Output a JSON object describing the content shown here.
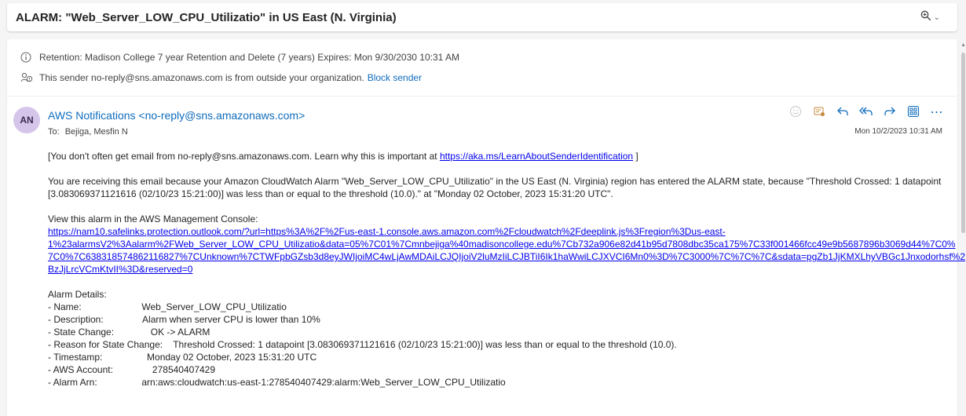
{
  "subject": "ALARM: \"Web_Server_LOW_CPU_Utilizatio\" in US East (N. Virginia)",
  "header": {
    "retention": "Retention: Madison College 7 year Retention and Delete (7 years) Expires: Mon 9/30/2030 10:31 AM",
    "outside_sender": "This sender no-reply@sns.amazonaws.com is from outside your organization.",
    "block_sender": "Block sender"
  },
  "message": {
    "avatar_initials": "AN",
    "sender": "AWS Notifications <no-reply@sns.amazonaws.com>",
    "to_label": "To:",
    "to_value": "Bejiga, Mesfin N",
    "date": "Mon 10/2/2023 10:31 AM"
  },
  "body": {
    "p1_text": "[You don't often get email from no-reply@sns.amazonaws.com. Learn why this is important at ",
    "p1_link": "https://aka.ms/LearnAboutSenderIdentification",
    "p1_end": " ]",
    "p2_line1": "You are receiving this email because your Amazon CloudWatch Alarm \"Web_Server_LOW_CPU_Utilizatio\" in the US East (N. Virginia) region has entered the ALARM state, because \"Threshold Crossed: 1 datapoint",
    "p2_line2": "[3.083069371121616 (02/10/23 15:21:00)] was less than or equal to the threshold (10.0).\" at \"Monday 02 October, 2023 15:31:20 UTC\".",
    "view_label": "View this alarm in the AWS Management Console:",
    "url_lines": [
      "https://nam10.safelinks.protection.outlook.com/?url=https%3A%2F%2Fus-east-1.console.aws.amazon.com%2Fcloudwatch%2Fdeeplink.js%3Fregion%3Dus-east-",
      "1%23alarmsV2%3Aalarm%2FWeb_Server_LOW_CPU_Utilizatio&data=05%7C01%7Cmnbejiga%40madisoncollege.edu%7Cb732a906e82d41b95d7808dbc35ca175%7C33f001466fcc49e9b5687896b3069d44%7C0%",
      "7C0%7C638318574862116827%7CUnknown%7CTWFpbGZsb3d8eyJWIjoiMC4wLjAwMDAiLCJQIjoiV2luMzIiLCJBTiI6Ik1haWwiLCJXVCI6Mn0%3D%7C3000%7C%7C%7C&sdata=pgZb1JjKMXLhyVBGc1Jnxodorhsf%2",
      "BzJjLrcVCmKtvII%3D&reserved=0"
    ],
    "details_title": "Alarm Details:",
    "details": [
      "- Name:                       Web_Server_LOW_CPU_Utilizatio",
      "- Description:               Alarm when server CPU is lower than 10%",
      "- State Change:              OK -> ALARM",
      "- Reason for State Change:    Threshold Crossed: 1 datapoint [3.083069371121616 (02/10/23 15:21:00)] was less than or equal to the threshold (10.0).",
      "- Timestamp:                 Monday 02 October, 2023 15:31:20 UTC",
      "- AWS Account:               278540407429",
      "- Alarm Arn:                 arn:aws:cloudwatch:us-east-1:278540407429:alarm:Web_Server_LOW_CPU_Utilizatio"
    ]
  },
  "icons": {
    "zoom": "zoom-icon",
    "info": "info-icon",
    "external": "external-people-icon",
    "emoji": "emoji-icon",
    "reply": "reply-icon",
    "reply_all": "reply-all-icon",
    "forward": "forward-icon",
    "apps": "apps-icon",
    "more": "more-icon"
  },
  "colors": {
    "accent": "#0f6cbd",
    "link": "#0000ee",
    "avatar_bg": "#d6c5ea"
  }
}
